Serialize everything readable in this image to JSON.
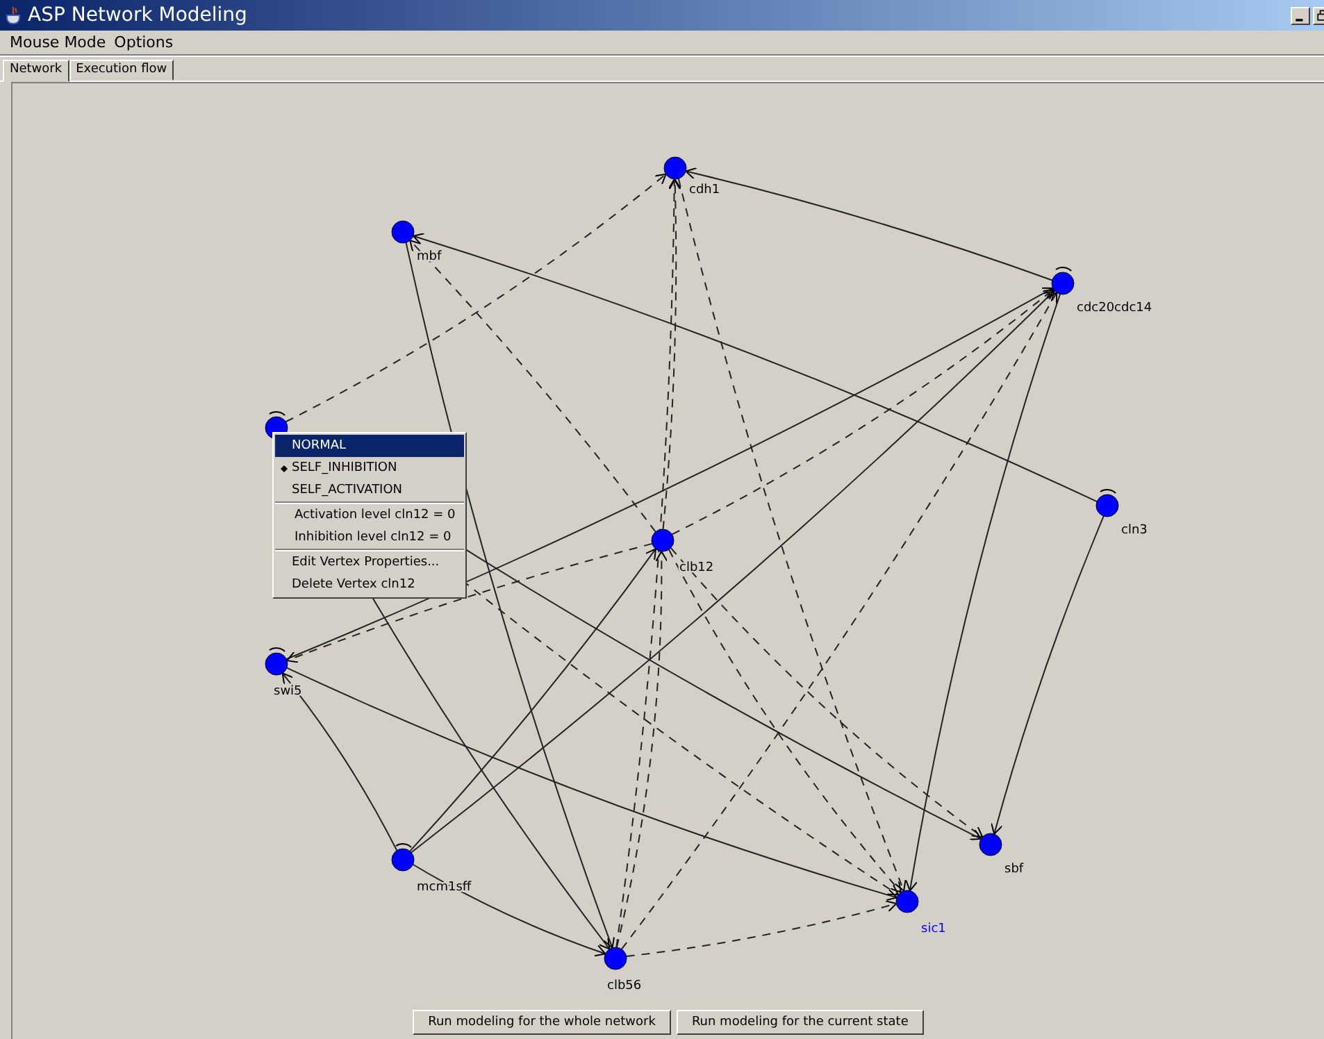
{
  "window": {
    "title": "ASP Network Modeling"
  },
  "menu_bar": [
    "Mouse Mode",
    "Options"
  ],
  "tabs": [
    {
      "label": "Network",
      "selected": true
    },
    {
      "label": "Execution flow",
      "selected": false
    }
  ],
  "network": {
    "nodes": [
      {
        "label": "cdh1",
        "self_loop": false,
        "picked": false
      },
      {
        "label": "mbf",
        "self_loop": false,
        "picked": false
      },
      {
        "self_loop": true
      },
      {
        "label": "cdc20cdc14",
        "self_loop": true,
        "picked": false
      },
      {
        "label": "cln3",
        "self_loop": true,
        "picked": false
      },
      {
        "label": "clb12",
        "self_loop": false,
        "picked": false
      },
      {
        "label": "swi5",
        "self_loop": true,
        "picked": false
      },
      {
        "label": "mcm1sff",
        "self_loop": true,
        "picked": false
      },
      {
        "label": "sbf",
        "self_loop": false,
        "picked": false
      },
      {
        "label": "sic1",
        "self_loop": false,
        "picked": true
      },
      {
        "label": "clb56",
        "self_loop": false,
        "picked": false
      }
    ]
  },
  "context_menu": {
    "groups": [
      [
        {
          "label": "NORMAL",
          "selected": true,
          "checked": false
        },
        {
          "label": "SELF_INHIBITION",
          "selected": false,
          "checked": true
        },
        {
          "label": "SELF_ACTIVATION",
          "selected": false,
          "checked": false
        }
      ],
      [
        {
          "label": "Activation level cln12 = 0",
          "selected": false,
          "checked": false
        },
        {
          "label": "Inhibition level cln12 = 0",
          "selected": false,
          "checked": false
        }
      ],
      [
        {
          "label": "Edit Vertex Properties...",
          "selected": false,
          "checked": false
        },
        {
          "label": "Delete Vertex cln12",
          "selected": false,
          "checked": false
        }
      ]
    ]
  },
  "buttons": [
    "Run modeling for the whole network",
    "Run modeling for the current state"
  ]
}
